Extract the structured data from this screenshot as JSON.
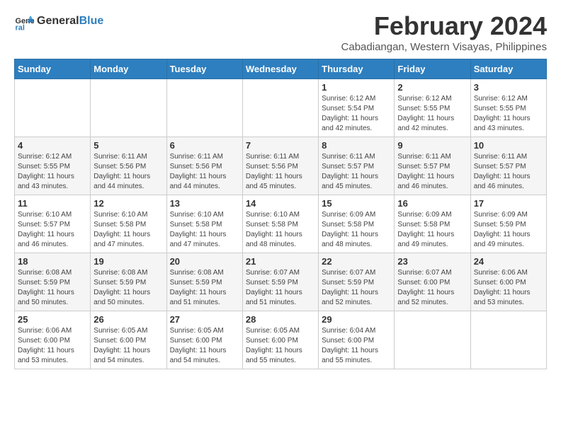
{
  "header": {
    "logo_text_general": "General",
    "logo_text_blue": "Blue",
    "month_year": "February 2024",
    "location": "Cabadiangan, Western Visayas, Philippines"
  },
  "weekdays": [
    "Sunday",
    "Monday",
    "Tuesday",
    "Wednesday",
    "Thursday",
    "Friday",
    "Saturday"
  ],
  "weeks": [
    [
      {
        "day": "",
        "info": ""
      },
      {
        "day": "",
        "info": ""
      },
      {
        "day": "",
        "info": ""
      },
      {
        "day": "",
        "info": ""
      },
      {
        "day": "1",
        "info": "Sunrise: 6:12 AM\nSunset: 5:54 PM\nDaylight: 11 hours\nand 42 minutes."
      },
      {
        "day": "2",
        "info": "Sunrise: 6:12 AM\nSunset: 5:55 PM\nDaylight: 11 hours\nand 42 minutes."
      },
      {
        "day": "3",
        "info": "Sunrise: 6:12 AM\nSunset: 5:55 PM\nDaylight: 11 hours\nand 43 minutes."
      }
    ],
    [
      {
        "day": "4",
        "info": "Sunrise: 6:12 AM\nSunset: 5:55 PM\nDaylight: 11 hours\nand 43 minutes."
      },
      {
        "day": "5",
        "info": "Sunrise: 6:11 AM\nSunset: 5:56 PM\nDaylight: 11 hours\nand 44 minutes."
      },
      {
        "day": "6",
        "info": "Sunrise: 6:11 AM\nSunset: 5:56 PM\nDaylight: 11 hours\nand 44 minutes."
      },
      {
        "day": "7",
        "info": "Sunrise: 6:11 AM\nSunset: 5:56 PM\nDaylight: 11 hours\nand 45 minutes."
      },
      {
        "day": "8",
        "info": "Sunrise: 6:11 AM\nSunset: 5:57 PM\nDaylight: 11 hours\nand 45 minutes."
      },
      {
        "day": "9",
        "info": "Sunrise: 6:11 AM\nSunset: 5:57 PM\nDaylight: 11 hours\nand 46 minutes."
      },
      {
        "day": "10",
        "info": "Sunrise: 6:11 AM\nSunset: 5:57 PM\nDaylight: 11 hours\nand 46 minutes."
      }
    ],
    [
      {
        "day": "11",
        "info": "Sunrise: 6:10 AM\nSunset: 5:57 PM\nDaylight: 11 hours\nand 46 minutes."
      },
      {
        "day": "12",
        "info": "Sunrise: 6:10 AM\nSunset: 5:58 PM\nDaylight: 11 hours\nand 47 minutes."
      },
      {
        "day": "13",
        "info": "Sunrise: 6:10 AM\nSunset: 5:58 PM\nDaylight: 11 hours\nand 47 minutes."
      },
      {
        "day": "14",
        "info": "Sunrise: 6:10 AM\nSunset: 5:58 PM\nDaylight: 11 hours\nand 48 minutes."
      },
      {
        "day": "15",
        "info": "Sunrise: 6:09 AM\nSunset: 5:58 PM\nDaylight: 11 hours\nand 48 minutes."
      },
      {
        "day": "16",
        "info": "Sunrise: 6:09 AM\nSunset: 5:58 PM\nDaylight: 11 hours\nand 49 minutes."
      },
      {
        "day": "17",
        "info": "Sunrise: 6:09 AM\nSunset: 5:59 PM\nDaylight: 11 hours\nand 49 minutes."
      }
    ],
    [
      {
        "day": "18",
        "info": "Sunrise: 6:08 AM\nSunset: 5:59 PM\nDaylight: 11 hours\nand 50 minutes."
      },
      {
        "day": "19",
        "info": "Sunrise: 6:08 AM\nSunset: 5:59 PM\nDaylight: 11 hours\nand 50 minutes."
      },
      {
        "day": "20",
        "info": "Sunrise: 6:08 AM\nSunset: 5:59 PM\nDaylight: 11 hours\nand 51 minutes."
      },
      {
        "day": "21",
        "info": "Sunrise: 6:07 AM\nSunset: 5:59 PM\nDaylight: 11 hours\nand 51 minutes."
      },
      {
        "day": "22",
        "info": "Sunrise: 6:07 AM\nSunset: 5:59 PM\nDaylight: 11 hours\nand 52 minutes."
      },
      {
        "day": "23",
        "info": "Sunrise: 6:07 AM\nSunset: 6:00 PM\nDaylight: 11 hours\nand 52 minutes."
      },
      {
        "day": "24",
        "info": "Sunrise: 6:06 AM\nSunset: 6:00 PM\nDaylight: 11 hours\nand 53 minutes."
      }
    ],
    [
      {
        "day": "25",
        "info": "Sunrise: 6:06 AM\nSunset: 6:00 PM\nDaylight: 11 hours\nand 53 minutes."
      },
      {
        "day": "26",
        "info": "Sunrise: 6:05 AM\nSunset: 6:00 PM\nDaylight: 11 hours\nand 54 minutes."
      },
      {
        "day": "27",
        "info": "Sunrise: 6:05 AM\nSunset: 6:00 PM\nDaylight: 11 hours\nand 54 minutes."
      },
      {
        "day": "28",
        "info": "Sunrise: 6:05 AM\nSunset: 6:00 PM\nDaylight: 11 hours\nand 55 minutes."
      },
      {
        "day": "29",
        "info": "Sunrise: 6:04 AM\nSunset: 6:00 PM\nDaylight: 11 hours\nand 55 minutes."
      },
      {
        "day": "",
        "info": ""
      },
      {
        "day": "",
        "info": ""
      }
    ]
  ]
}
